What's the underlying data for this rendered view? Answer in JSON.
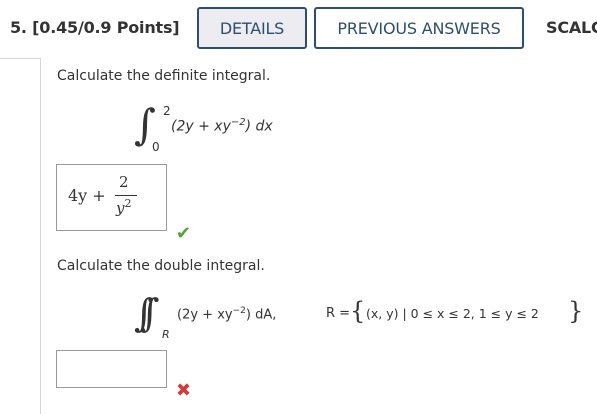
{
  "header": {
    "question_number": "5. [0.45/0.9 Points]",
    "details_label": "DETAILS",
    "previous_answers_label": "PREVIOUS ANSWERS",
    "scalc_label": "SCALC"
  },
  "part1": {
    "prompt": "Calculate the definite integral.",
    "integral_upper": "2",
    "integral_lower": "0",
    "integrand": "(2y + xy",
    "exponent": "−2",
    "close": ") dx",
    "answer": {
      "term1": "4y +",
      "numerator": "2",
      "denominator": "y",
      "den_exp": "2"
    },
    "status": "correct"
  },
  "part2": {
    "prompt": "Calculate the double integral.",
    "region_sub": "R",
    "integrand": "(2y + xy",
    "exponent": "−2",
    "close": ") dA,",
    "region_def": "R = ",
    "region_set": "(x, y) | 0 ≤ x ≤ 2, 1 ≤ y ≤ 2",
    "answer": "",
    "status": "incorrect"
  },
  "icons": {
    "correct": "check-icon",
    "incorrect": "cross-icon"
  },
  "colors": {
    "accent": "#2e4e6f",
    "correct": "#5aa33b",
    "incorrect": "#d23b3b"
  }
}
